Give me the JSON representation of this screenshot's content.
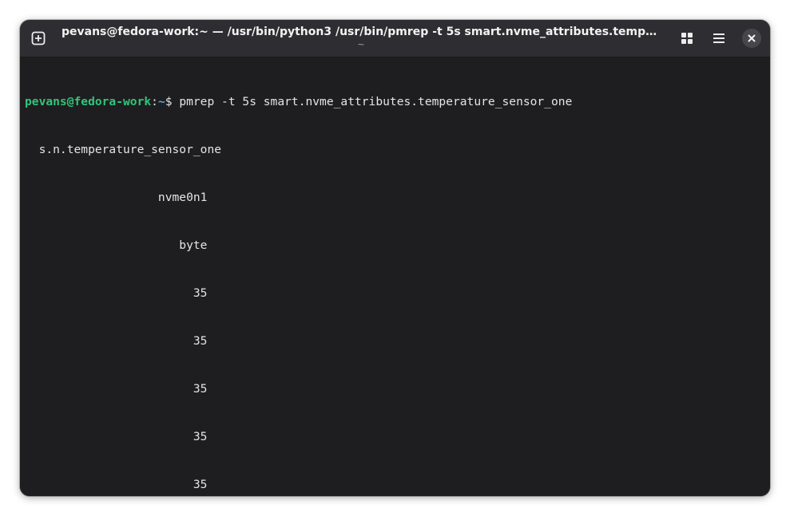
{
  "window": {
    "title": "pevans@fedora-work:~ — /usr/bin/python3 /usr/bin/pmrep -t 5s smart.nvme_attributes.temperature...",
    "subtitle": "~"
  },
  "icons": {
    "new_tab": "new-tab-icon",
    "grid": "grid-view-icon",
    "menu": "hamburger-menu-icon",
    "close": "close-icon"
  },
  "colors": {
    "terminal_bg": "#1e1e20",
    "headerbar_bg": "#2e2e32",
    "prompt_user": "#33c47a",
    "prompt_path": "#4fa8e8",
    "text": "#e4e4e4"
  },
  "terminal": {
    "prompt": {
      "user_host": "pevans@fedora-work",
      "sep": ":",
      "path": "~",
      "symbol": "$ ",
      "command": "pmrep -t 5s smart.nvme_attributes.temperature_sensor_one"
    },
    "output": {
      "metric_header": "  s.n.temperature_sensor_one",
      "instance_header": "                   nvme0n1",
      "units_header": "                      byte",
      "values": [
        "                        35",
        "                        35",
        "                        35",
        "                        35",
        "                        35"
      ]
    }
  }
}
